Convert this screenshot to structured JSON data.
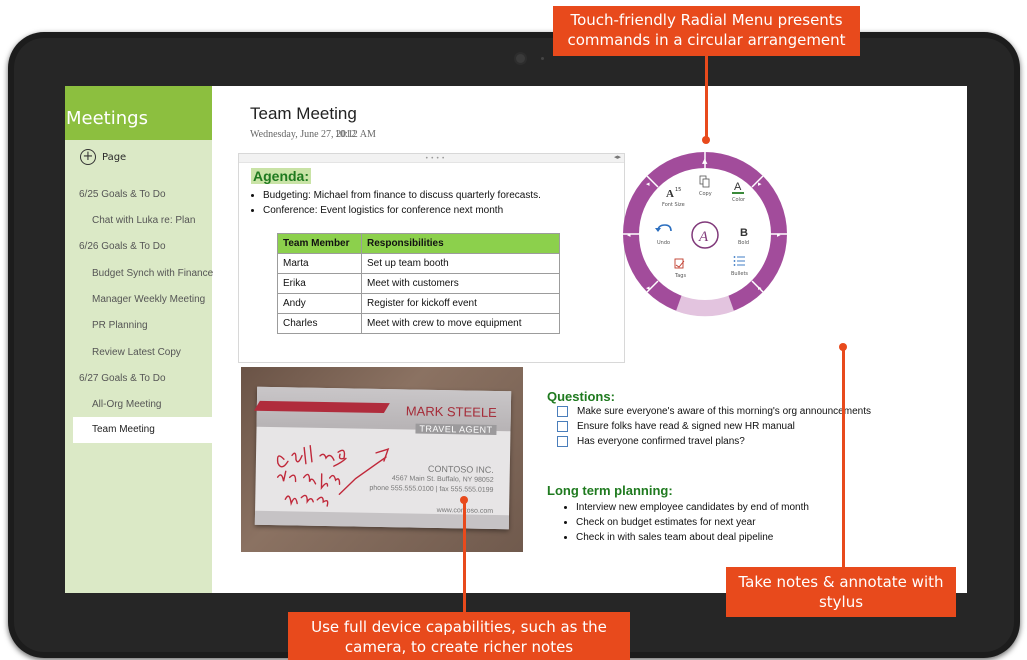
{
  "app": {
    "notebook_title": "Meetings",
    "add_page_label": "Page"
  },
  "sidebar": {
    "items": [
      {
        "label": "6/25 Goals & To Do",
        "level": 0
      },
      {
        "label": "Chat with Luka re: Plan",
        "level": 1
      },
      {
        "label": "6/26 Goals & To Do",
        "level": 0
      },
      {
        "label": "Budget Synch with Finance",
        "level": 1
      },
      {
        "label": "Manager Weekly Meeting",
        "level": 1
      },
      {
        "label": "PR Planning",
        "level": 1
      },
      {
        "label": "Review Latest Copy",
        "level": 1
      },
      {
        "label": "6/27 Goals & To Do",
        "level": 0
      },
      {
        "label": "All-Org Meeting",
        "level": 1
      },
      {
        "label": "Team Meeting",
        "level": 1,
        "selected": true
      }
    ]
  },
  "page": {
    "title": "Team Meeting",
    "date": "Wednesday, June 27, 2012",
    "time": "10:12 AM",
    "agenda": {
      "heading": "Agenda:",
      "bullets": [
        "Budgeting:  Michael from finance to discuss quarterly forecasts.",
        "Conference: Event logistics for conference next month"
      ]
    },
    "table": {
      "headers": [
        "Team Member",
        "Responsibilities"
      ],
      "rows": [
        [
          "Marta",
          "Set up team booth"
        ],
        [
          "Erika",
          "Meet with customers"
        ],
        [
          "Andy",
          "Register for kickoff event"
        ],
        [
          "Charles",
          "Meet with crew to move equipment"
        ]
      ]
    },
    "questions": {
      "heading": "Questions:",
      "items": [
        "Make sure everyone's aware of this morning's org announcements",
        "Ensure folks have read & signed new HR manual",
        "Has everyone confirmed travel plans?"
      ]
    },
    "planning": {
      "heading": "Long term planning:",
      "bullets": [
        "Interview new employee candidates by end of month",
        "Check on budget estimates for next year",
        "Check in with sales team about deal pipeline"
      ]
    },
    "business_card": {
      "name": "MARK STEELE",
      "title": "TRAVEL AGENT",
      "company": "CONTOSO INC.",
      "address": "4567 Main St. Buffalo, NY 98052",
      "phone": "phone 555.555.0100  |  fax 555.555.0199",
      "web": "www.contoso.com",
      "handwriting": "Call me to plan your trip!"
    }
  },
  "radial_menu": {
    "items": {
      "font_size": "Font Size",
      "copy": "Copy",
      "color": "Color",
      "undo": "Undo",
      "bold": "Bold",
      "tags": "Tags",
      "bullets": "Bullets"
    },
    "center_icon": "onenote-icon",
    "accent_color": "#a24c9b"
  },
  "callouts": {
    "radial": "Touch-friendly Radial Menu presents commands in a circular arrangement",
    "stylus": "Take notes & annotate with stylus",
    "camera": "Use full device capabilities, such as the camera, to create richer notes"
  },
  "colors": {
    "sidebar_header": "#8cbf3f",
    "sidebar_bg": "#dbe9c6",
    "heading_green": "#1f7a1f",
    "table_header": "#8cd04c",
    "callout": "#e84a1c"
  }
}
